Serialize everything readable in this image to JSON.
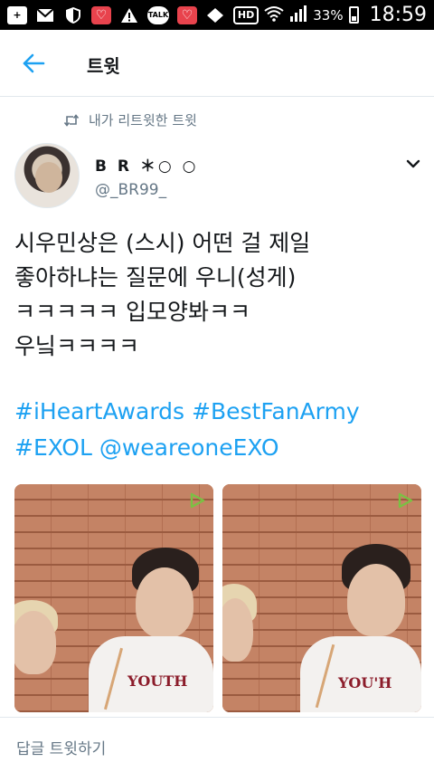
{
  "status_bar": {
    "icons": [
      "plus-icon",
      "mail-icon",
      "shield-icon",
      "heart-app-icon",
      "warning-icon",
      "talk-icon",
      "heart-app-icon",
      "diamond-icon",
      "hd-icon",
      "wifi-icon",
      "signal-icon"
    ],
    "talk_label": "TALK",
    "hd_label": "HD",
    "battery": "33%",
    "battery_level": 0.33,
    "time": "18:59"
  },
  "header": {
    "title": "트윗"
  },
  "tweet": {
    "retweet_context": "내가 리트윗한 트윗",
    "author": {
      "display_name": "B R ＊○ ○",
      "username": "@_BR99_"
    },
    "text_lines": [
      "시우민상은 (스시) 어떤 걸 제일",
      "좋아하냐는 질문에 우니(성게)",
      "ㅋㅋㅋㅋㅋ 입모양봐ㅋㅋ",
      "우닠ㅋㅋㅋㅋ"
    ],
    "hashtag_lines": [
      "#iHeartAwards #BestFanArmy",
      "#EXOL @weareoneEXO"
    ],
    "media_print": [
      "YOUTH",
      "YOU'H"
    ]
  },
  "reply": {
    "placeholder": "답글 트윗하기"
  },
  "colors": {
    "accent": "#1da1f2",
    "secondary_text": "#657786",
    "divider": "#e1e8ed",
    "play_badge": "#7ac143"
  }
}
